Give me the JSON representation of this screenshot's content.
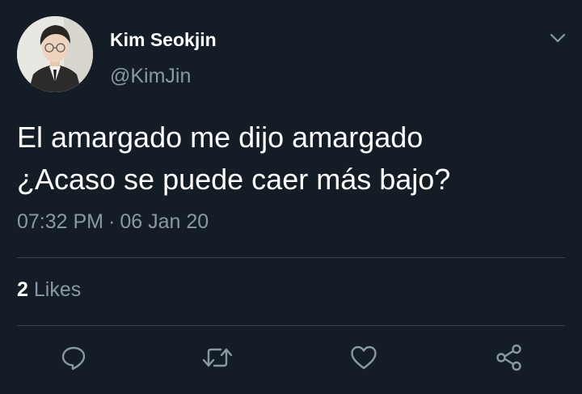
{
  "tweet": {
    "author": {
      "display_name": "Kim Seokjin",
      "handle": "@KimJin",
      "avatar": "profile-photo"
    },
    "text_lines": [
      "El amargado me dijo amargado",
      "¿Acaso se puede caer más bajo?"
    ],
    "time": "07:32 PM",
    "separator": "·",
    "date": "06 Jan 20",
    "likes": {
      "count": "2",
      "label": "Likes"
    }
  },
  "icons": {
    "menu": "chevron-down-icon",
    "reply": "reply-icon",
    "retweet": "retweet-icon",
    "like": "heart-icon",
    "share": "share-icon"
  },
  "colors": {
    "background": "#141d26",
    "primary_text": "#ffffff",
    "secondary_text": "#8899a6",
    "divider": "#38444d"
  }
}
